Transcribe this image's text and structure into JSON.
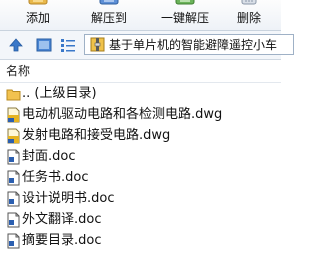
{
  "toolbar": {
    "add_label": "添加",
    "extract_label": "解压到",
    "oneclick_label": "一键解压",
    "delete_label": "删除"
  },
  "address": {
    "path": "基于单片机的智能避障遥控小车"
  },
  "columns": {
    "name": "名称"
  },
  "files": [
    {
      "name": ".. (上级目录)",
      "icon": "folder-up-icon"
    },
    {
      "name": "电动机驱动电路和各检测电路.dwg",
      "icon": "dwg-file-icon"
    },
    {
      "name": "发射电路和接受电路.dwg",
      "icon": "dwg-file-icon"
    },
    {
      "name": "封面.doc",
      "icon": "doc-file-icon"
    },
    {
      "name": "任务书.doc",
      "icon": "doc-file-icon"
    },
    {
      "name": "设计说明书.doc",
      "icon": "doc-file-icon"
    },
    {
      "name": "外文翻译.doc",
      "icon": "doc-file-icon"
    },
    {
      "name": "摘要目录.doc",
      "icon": "doc-file-icon"
    }
  ],
  "colors": {
    "accent": "#3a78c9",
    "folder": "#f2c24f",
    "dwg": "#e6b422",
    "doc_blue": "#2b5fb0"
  }
}
